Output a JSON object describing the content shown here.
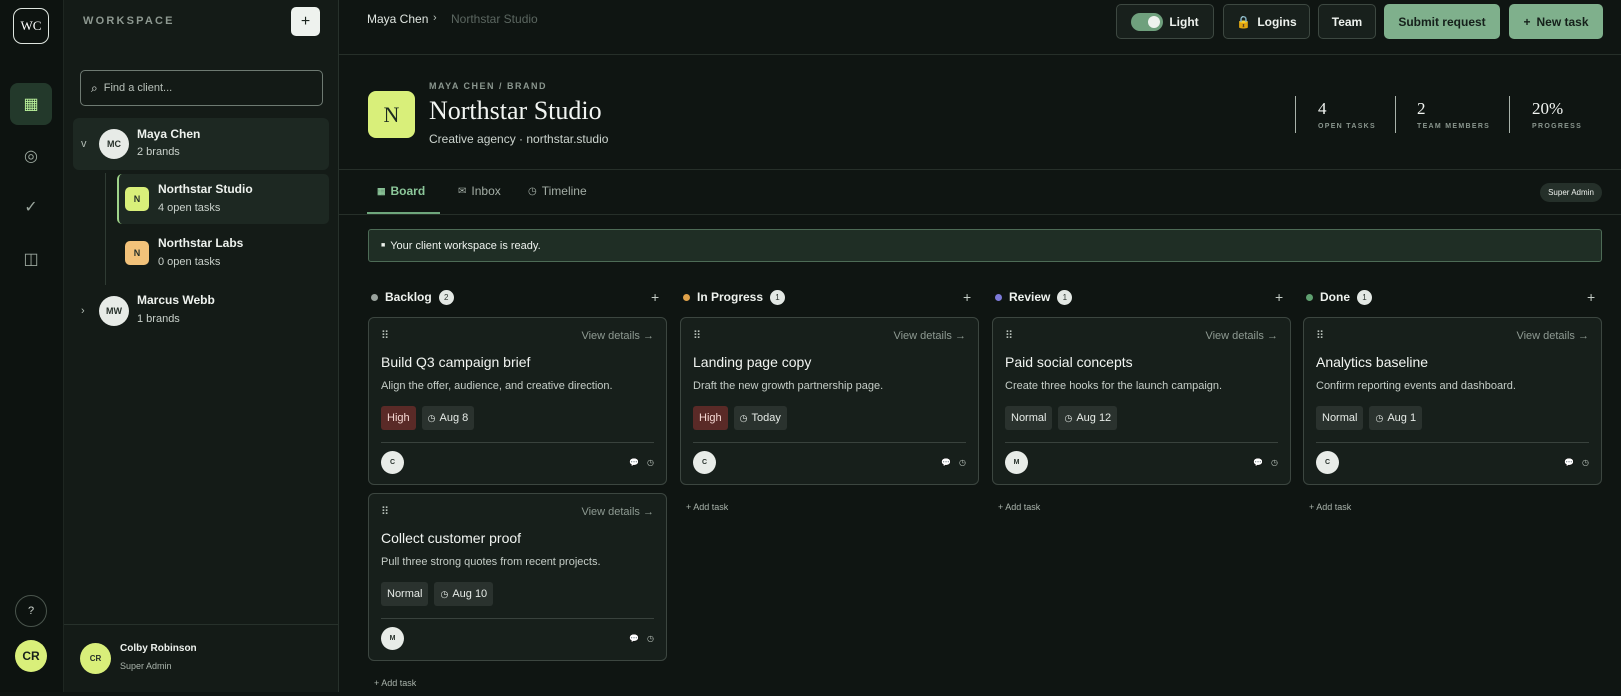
{
  "rail": {
    "logo": "WC",
    "items": [
      {
        "icon": "grid-icon",
        "glyph": "▦"
      },
      {
        "icon": "target-icon",
        "glyph": "◎"
      },
      {
        "icon": "check-icon",
        "glyph": "✓"
      },
      {
        "icon": "book-icon",
        "glyph": "◫"
      }
    ],
    "help": "?",
    "avatar": "CR"
  },
  "sidebar": {
    "title": "WORKSPACE",
    "add": "+",
    "search_placeholder": "Find a client...",
    "clients": [
      {
        "initials": "MC",
        "name": "Maya Chen",
        "sub": "2 brands",
        "chevron": "v"
      },
      {
        "initials": "MW",
        "name": "Marcus Webb",
        "sub": "1 brands",
        "chevron": "›"
      }
    ],
    "brands": [
      {
        "initials": "N",
        "name": "Northstar Studio",
        "sub": "4 open tasks",
        "color": "#d9ef7a"
      },
      {
        "initials": "N",
        "name": "Northstar Labs",
        "sub": "0 open tasks",
        "color": "#f2c27a"
      }
    ],
    "user": {
      "initials": "CR",
      "name": "Colby Robinson",
      "role": "Super Admin"
    }
  },
  "header": {
    "breadcrumb": [
      "Maya Chen",
      "›",
      "Northstar Studio"
    ],
    "buttons": {
      "light": "Light",
      "logins": "Logins",
      "team": "Team",
      "submit": "Submit request",
      "new_task": "New task"
    }
  },
  "brand": {
    "initial": "N",
    "eyebrow": "MAYA CHEN / BRAND",
    "title": "Northstar Studio",
    "subtitle": "Creative agency · northstar.studio",
    "stats": [
      {
        "value": "4",
        "label": "OPEN TASKS"
      },
      {
        "value": "2",
        "label": "TEAM MEMBERS"
      },
      {
        "value": "20%",
        "label": "PROGRESS"
      }
    ]
  },
  "tabs": [
    "Board",
    "Inbox",
    "Timeline"
  ],
  "role_pill": "Super Admin",
  "notice": "Your client workspace is ready.",
  "columns": [
    {
      "title": "Backlog",
      "count": "2",
      "color": "#9aa39d",
      "add": "+",
      "add_task": "+ Add task"
    },
    {
      "title": "In Progress",
      "count": "1",
      "color": "#e0a24a",
      "add": "+",
      "add_task": "+ Add task"
    },
    {
      "title": "Review",
      "count": "1",
      "color": "#7d7ad8",
      "add": "+",
      "add_task": "+ Add task"
    },
    {
      "title": "Done",
      "count": "1",
      "color": "#5fa070",
      "add": "+",
      "add_task": "+ Add task"
    }
  ],
  "cards": [
    {
      "title": "Build Q3 campaign brief",
      "desc": "Align the offer, audience, and creative direction.",
      "priority": "High",
      "date": "Aug 8",
      "avatar": "C",
      "view": "View details →"
    },
    {
      "title": "Collect customer proof",
      "desc": "Pull three strong quotes from recent projects.",
      "priority": "Normal",
      "date": "Aug 10",
      "avatar": "M",
      "view": "View details →"
    },
    {
      "title": "Landing page copy",
      "desc": "Draft the new growth partnership page.",
      "priority": "High",
      "date": "Today",
      "avatar": "C",
      "view": "View details →"
    },
    {
      "title": "Paid social concepts",
      "desc": "Create three hooks for the launch campaign.",
      "priority": "Normal",
      "date": "Aug 12",
      "avatar": "M",
      "view": "View details →"
    },
    {
      "title": "Analytics baseline",
      "desc": "Confirm reporting events and dashboard.",
      "priority": "Normal",
      "date": "Aug 1",
      "avatar": "C",
      "view": "View details →"
    }
  ]
}
